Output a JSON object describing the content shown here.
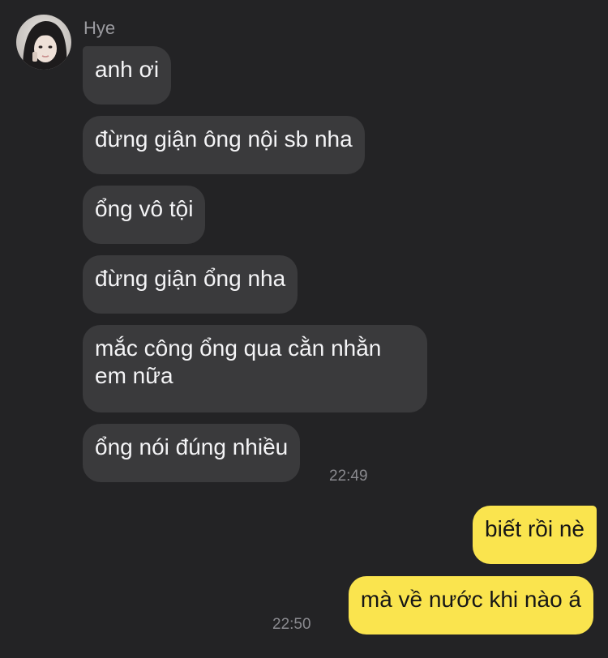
{
  "chat": {
    "sender_name": "Hye",
    "incoming": [
      {
        "text": "anh ơi"
      },
      {
        "text": "đừng giận ông nội sb nha"
      },
      {
        "text": "ổng vô tội"
      },
      {
        "text": "đừng giận ổng nha"
      },
      {
        "text": "mắc công ổng qua cằn nhằn em nữa"
      },
      {
        "text": "ổng nói đúng nhiều"
      }
    ],
    "incoming_time": "22:49",
    "outgoing": [
      {
        "text": "biết rồi nè"
      },
      {
        "text": "mà về nước khi nào á"
      }
    ],
    "outgoing_time": "22:50"
  },
  "colors": {
    "background": "#232325",
    "incoming_bubble": "#3a3a3c",
    "outgoing_bubble": "#fae44e"
  },
  "icons": {
    "avatar": "user-avatar-photo"
  }
}
